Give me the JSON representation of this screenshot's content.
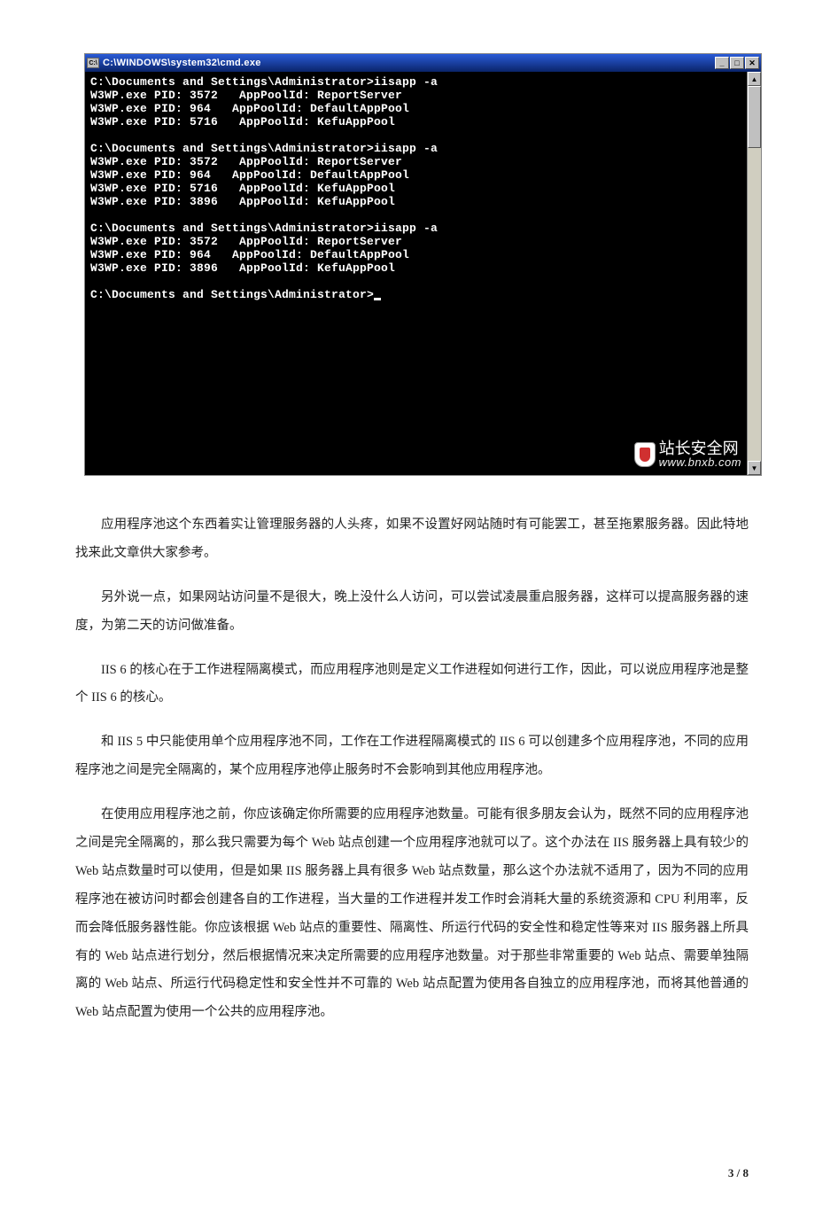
{
  "cmd": {
    "icon_label": "C:\\",
    "title": "C:\\WINDOWS\\system32\\cmd.exe",
    "buttons": {
      "min": "_",
      "max": "□",
      "close": "✕"
    },
    "scroll": {
      "up": "▲",
      "down": "▼"
    },
    "lines": [
      "C:\\Documents and Settings\\Administrator>iisapp -a",
      "W3WP.exe PID: 3572   AppPoolId: ReportServer",
      "W3WP.exe PID: 964   AppPoolId: DefaultAppPool",
      "W3WP.exe PID: 5716   AppPoolId: KefuAppPool",
      "",
      "C:\\Documents and Settings\\Administrator>iisapp -a",
      "W3WP.exe PID: 3572   AppPoolId: ReportServer",
      "W3WP.exe PID: 964   AppPoolId: DefaultAppPool",
      "W3WP.exe PID: 5716   AppPoolId: KefuAppPool",
      "W3WP.exe PID: 3896   AppPoolId: KefuAppPool",
      "",
      "C:\\Documents and Settings\\Administrator>iisapp -a",
      "W3WP.exe PID: 3572   AppPoolId: ReportServer",
      "W3WP.exe PID: 964   AppPoolId: DefaultAppPool",
      "W3WP.exe PID: 3896   AppPoolId: KefuAppPool",
      "",
      "C:\\Documents and Settings\\Administrator>"
    ],
    "watermark": {
      "title": "站长安全网",
      "sub": "www.bnxb.com"
    }
  },
  "article": {
    "p1": "应用程序池这个东西着实让管理服务器的人头疼，如果不设置好网站随时有可能罢工，甚至拖累服务器。因此特地找来此文章供大家参考。",
    "p2": "另外说一点，如果网站访问量不是很大，晚上没什么人访问，可以尝试凌晨重启服务器，这样可以提高服务器的速度，为第二天的访问做准备。",
    "p3": "IIS 6 的核心在于工作进程隔离模式，而应用程序池则是定义工作进程如何进行工作，因此，可以说应用程序池是整个 IIS 6 的核心。",
    "p4": "和 IIS 5 中只能使用单个应用程序池不同，工作在工作进程隔离模式的 IIS 6 可以创建多个应用程序池，不同的应用程序池之间是完全隔离的，某个应用程序池停止服务时不会影响到其他应用程序池。",
    "p5": "在使用应用程序池之前，你应该确定你所需要的应用程序池数量。可能有很多朋友会认为，既然不同的应用程序池之间是完全隔离的，那么我只需要为每个 Web 站点创建一个应用程序池就可以了。这个办法在 IIS 服务器上具有较少的 Web 站点数量时可以使用，但是如果 IIS 服务器上具有很多 Web 站点数量，那么这个办法就不适用了，因为不同的应用程序池在被访问时都会创建各自的工作进程，当大量的工作进程并发工作时会消耗大量的系统资源和 CPU 利用率，反而会降低服务器性能。你应该根据 Web 站点的重要性、隔离性、所运行代码的安全性和稳定性等来对 IIS 服务器上所具有的 Web 站点进行划分，然后根据情况来决定所需要的应用程序池数量。对于那些非常重要的 Web 站点、需要单独隔离的 Web 站点、所运行代码稳定性和安全性并不可靠的 Web 站点配置为使用各自独立的应用程序池，而将其他普通的 Web 站点配置为使用一个公共的应用程序池。"
  },
  "page": {
    "num": "3 / 8"
  }
}
